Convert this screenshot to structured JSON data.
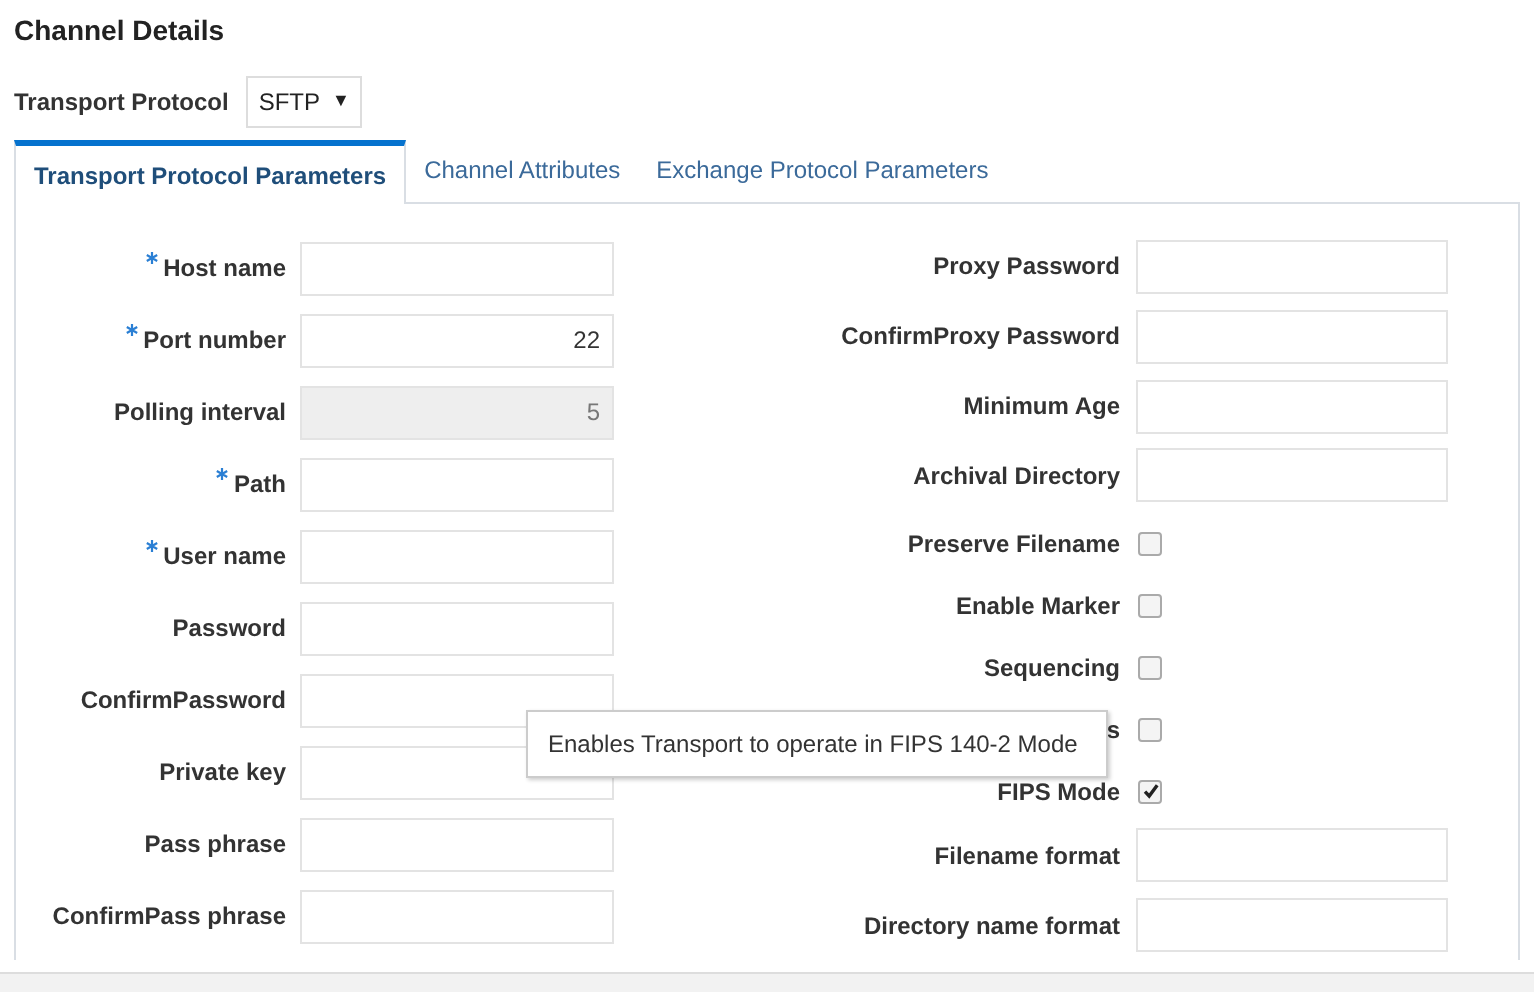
{
  "title": "Channel Details",
  "transport_protocol": {
    "label": "Transport Protocol",
    "value": "SFTP",
    "caret": "▼"
  },
  "tabs": [
    {
      "label": "Transport Protocol Parameters",
      "selected": true
    },
    {
      "label": "Channel Attributes",
      "selected": false
    },
    {
      "label": "Exchange Protocol Parameters",
      "selected": false
    }
  ],
  "left_fields": [
    {
      "label": "Host name",
      "required": true,
      "disabled": false
    },
    {
      "label": "Port number",
      "required": true,
      "disabled": false,
      "value": "22"
    },
    {
      "label": "Polling interval",
      "required": false,
      "disabled": true,
      "value": "5"
    },
    {
      "label": "Path",
      "required": true,
      "disabled": false
    },
    {
      "label": "User name",
      "required": true,
      "disabled": false
    },
    {
      "label": "Password",
      "required": false,
      "disabled": false
    },
    {
      "label": "ConfirmPassword",
      "required": false,
      "disabled": false
    },
    {
      "label": "Private key",
      "required": false,
      "disabled": false
    },
    {
      "label": "Pass phrase",
      "required": false,
      "disabled": false
    },
    {
      "label": "ConfirmPass phrase",
      "required": false,
      "disabled": false
    }
  ],
  "right_fields": [
    {
      "kind": "text",
      "label": "Proxy Password"
    },
    {
      "kind": "text",
      "label": "ConfirmProxy Password"
    },
    {
      "kind": "text",
      "label": "Minimum Age"
    },
    {
      "kind": "text",
      "label": "Archival Directory"
    },
    {
      "kind": "checkbox",
      "label": "Preserve Filename",
      "checked": false
    },
    {
      "kind": "checkbox",
      "label": "Enable Marker",
      "checked": false
    },
    {
      "kind": "checkbox",
      "label": "Sequencing",
      "checked": false
    },
    {
      "kind": "checkbox",
      "label": "s",
      "checked": false
    },
    {
      "kind": "checkbox",
      "label": "FIPS Mode",
      "checked": true
    },
    {
      "kind": "text",
      "label": "Filename format"
    },
    {
      "kind": "text",
      "label": "Directory name format"
    }
  ],
  "tooltip": {
    "text": "Enables Transport to operate in FIPS 140-2 Mode"
  }
}
